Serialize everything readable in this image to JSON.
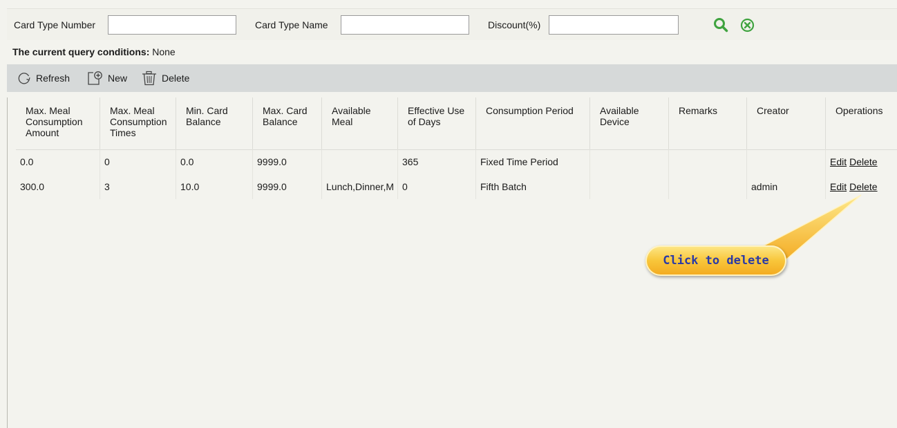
{
  "search": {
    "fields": [
      {
        "label": "Card Type Number",
        "value": "",
        "placeholder": ""
      },
      {
        "label": "Card Type Name",
        "value": "",
        "placeholder": ""
      },
      {
        "label": "Discount(%)",
        "value": "",
        "placeholder": ""
      }
    ],
    "search_icon": "magnifier-icon",
    "clear_icon": "circle-x-icon",
    "accent": "#3fa33f"
  },
  "query": {
    "label": "The current query conditions:",
    "value": " None"
  },
  "toolbar": {
    "refresh_label": "Refresh",
    "new_label": "New",
    "delete_label": "Delete",
    "refresh_icon": "refresh-icon",
    "new_icon": "new-document-icon",
    "delete_icon": "recycle-bin-icon"
  },
  "table": {
    "columns": [
      "Max. Meal\nConsumption\nAmount",
      "Max. Meal\nConsumption\nTimes",
      "Min. Card\nBalance",
      "Max. Card\nBalance",
      "Available\nMeal",
      "Effective Use\nof Days",
      "Consumption Period",
      "Available\nDevice",
      "Remarks",
      "Creator",
      "Operations"
    ],
    "rows": [
      {
        "cells": [
          "0.0",
          "0",
          "0.0",
          "9999.0",
          "",
          "365",
          "Fixed Time Period",
          "",
          "",
          ""
        ],
        "edit": "Edit",
        "delete": "Delete"
      },
      {
        "cells": [
          "300.0",
          "3",
          "10.0",
          "9999.0",
          "Lunch,Dinner,M",
          "0",
          "Fifth Batch",
          "",
          "",
          "admin"
        ],
        "edit": "Edit",
        "delete": "Delete"
      }
    ]
  },
  "callout": {
    "text": "Click to delete",
    "color_top": "#fde88a",
    "color_bottom": "#f3a91f",
    "text_color": "#2a3aa6"
  }
}
